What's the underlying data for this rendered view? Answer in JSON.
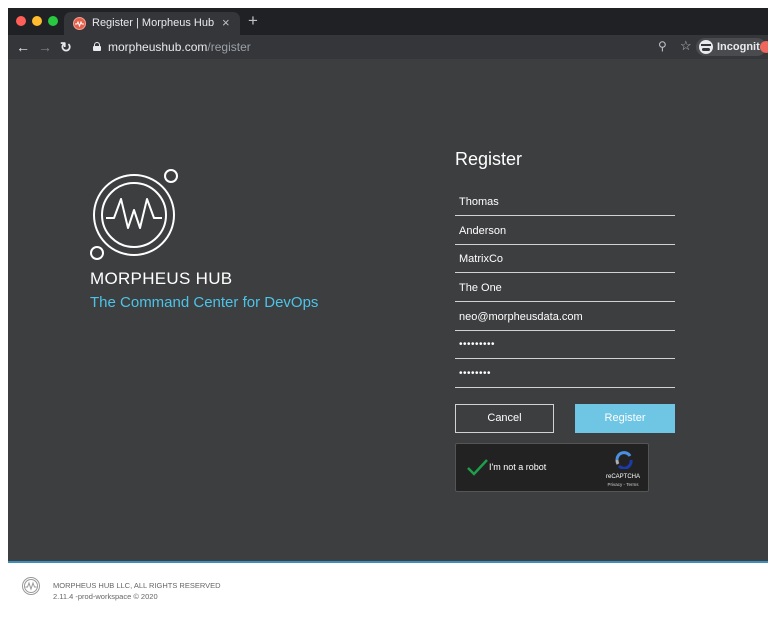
{
  "browser": {
    "tab_title": "Register | Morpheus Hub",
    "tab_close": "×",
    "new_tab": "+",
    "url_host": "morpheushub.com",
    "url_path": "/register",
    "profile_label": "Incognito",
    "icons": {
      "back": "back-arrow-icon",
      "forward": "forward-arrow-icon",
      "reload": "reload-icon",
      "lock": "lock-icon",
      "zoom": "zoom-icon",
      "bookmark": "star-icon",
      "profile": "incognito-icon"
    }
  },
  "branding": {
    "name": "MORPHEUS HUB",
    "tagline": "The Command Center for DevOps",
    "accent_color": "#4cc4e8"
  },
  "form": {
    "title": "Register",
    "fields": [
      {
        "name": "first-name",
        "value": "Thomas"
      },
      {
        "name": "last-name",
        "value": "Anderson"
      },
      {
        "name": "company",
        "value": "MatrixCo"
      },
      {
        "name": "title",
        "value": "The One"
      },
      {
        "name": "email",
        "value": "neo@morpheusdata.com"
      },
      {
        "name": "password",
        "value": "•••••••••"
      },
      {
        "name": "confirm-password",
        "value": "••••••••"
      }
    ],
    "cancel_label": "Cancel",
    "register_label": "Register",
    "register_color": "#6ec5e4"
  },
  "captcha": {
    "label": "I'm not a robot",
    "checked": true,
    "brand": "reCAPTCHA",
    "links": "Privacy - Terms"
  },
  "footer": {
    "copyright": "MORPHEUS HUB LLC, ALL RIGHTS RESERVED",
    "version": "2.11.4 -prod-workspace © 2020"
  }
}
